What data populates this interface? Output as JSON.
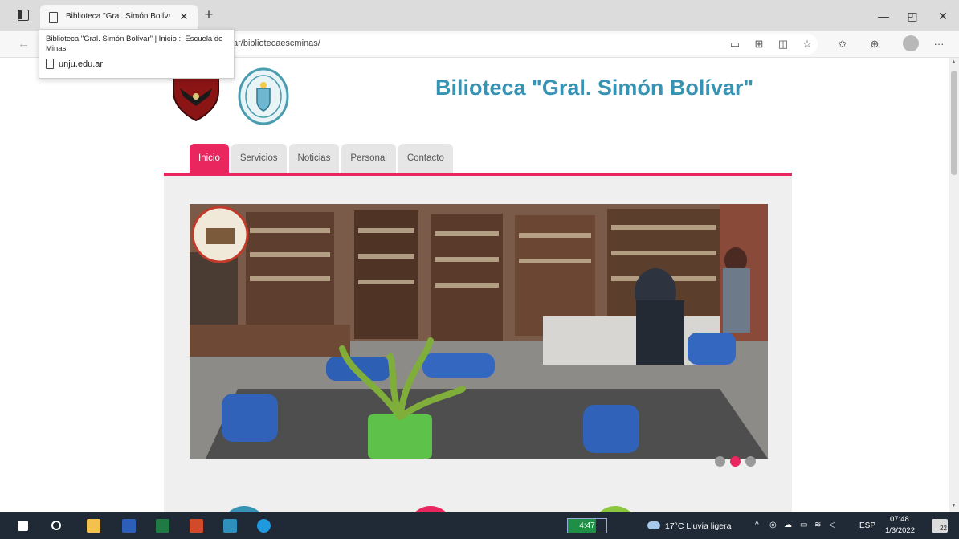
{
  "browser": {
    "tab": {
      "title": "Biblioteca \"Gral. Simón Bolívar\"",
      "close_glyph": "✕"
    },
    "new_tab_glyph": "+",
    "window_controls": {
      "minimize": "—",
      "restore": "◰",
      "close": "✕"
    },
    "address": {
      "url_visible": "ar/bibliotecaescminas/"
    },
    "tooltip": {
      "title": "Biblioteca \"Gral. Simón Bolívar\" | Inicio :: Escuela de Minas",
      "domain": "unju.edu.ar"
    },
    "toolbar_icons": [
      "reader-view-icon",
      "apps-icon",
      "split-screen-icon",
      "favorite-add-icon",
      "favorites-icon",
      "collections-icon",
      "profile-icon",
      "more-icon"
    ]
  },
  "site": {
    "title": "Bilioteca \"Gral. Simón Bolívar\"",
    "nav": [
      {
        "label": "Inicio",
        "active": true
      },
      {
        "label": "Servicios",
        "active": false
      },
      {
        "label": "Noticias",
        "active": false
      },
      {
        "label": "Personal",
        "active": false
      },
      {
        "label": "Contacto",
        "active": false
      }
    ],
    "carousel": {
      "slides": 3,
      "active_slide": 2
    },
    "accent_color": "#e9265e",
    "title_color": "#3793b3"
  },
  "taskbar": {
    "battery": {
      "text": "4:47",
      "level": 0.72
    },
    "weather": "17°C  Lluvia ligera",
    "language": "ESP",
    "time": "07:48",
    "date": "1/3/2022",
    "notifications": "22",
    "apps": [
      "windows-start-icon",
      "search-icon",
      "file-explorer-icon",
      "word-icon",
      "excel-icon",
      "powerpoint-icon",
      "app-icon",
      "edge-icon"
    ]
  }
}
